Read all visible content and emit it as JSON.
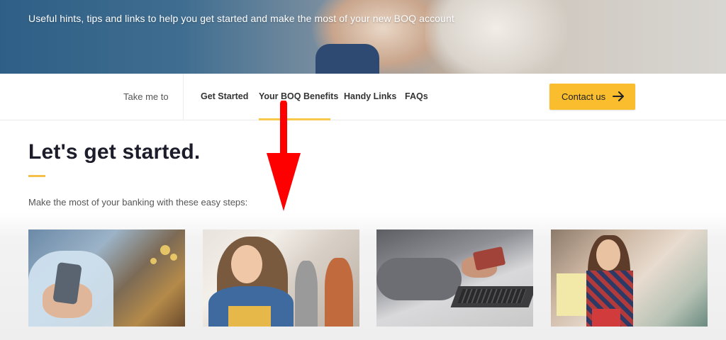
{
  "hero": {
    "tagline": "Useful hints, tips and links to help you get started and make the most of your new BOQ account"
  },
  "nav": {
    "take_me_to": "Take me to",
    "links": [
      {
        "label": "Get Started",
        "active": false
      },
      {
        "label": "Your BOQ Benefits",
        "active": true
      },
      {
        "label": "Handy Links",
        "active": false
      },
      {
        "label": "FAQs",
        "active": false
      }
    ],
    "contact_button": {
      "label": "Contact us",
      "icon": "arrow-right-icon"
    }
  },
  "main": {
    "title": "Let's get started.",
    "subtitle": "Make the most of your banking with these easy steps:",
    "cards": [
      {
        "image": "man-holding-smartphone"
      },
      {
        "image": "smiling-student-with-folders"
      },
      {
        "image": "hands-credit-card-laptop"
      },
      {
        "image": "woman-shopping-with-bags"
      }
    ]
  },
  "colors": {
    "accent": "#f9bd2d",
    "heading": "#1c1c2a",
    "annotation": "#ff0000"
  }
}
